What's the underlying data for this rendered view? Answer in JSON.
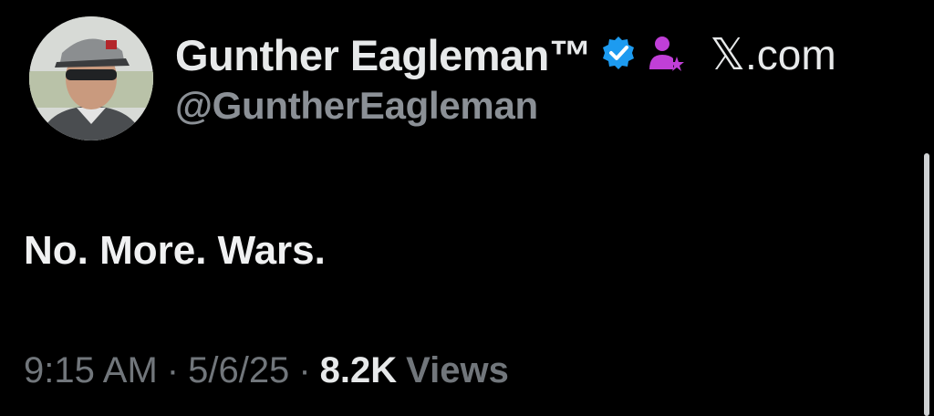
{
  "author": {
    "display_name": "Gunther Eagleman™",
    "handle": "@GuntherEagleman",
    "verified_color": "#1d9bf0",
    "affiliate_color": "#c03fd7"
  },
  "source": {
    "icon": "x-logo-icon",
    "label": ".com"
  },
  "tweet": {
    "text": "No. More. Wars."
  },
  "meta": {
    "time": "9:15 AM",
    "separator": "·",
    "date": "5/6/25",
    "views_count": "8.2K",
    "views_label": "Views"
  }
}
